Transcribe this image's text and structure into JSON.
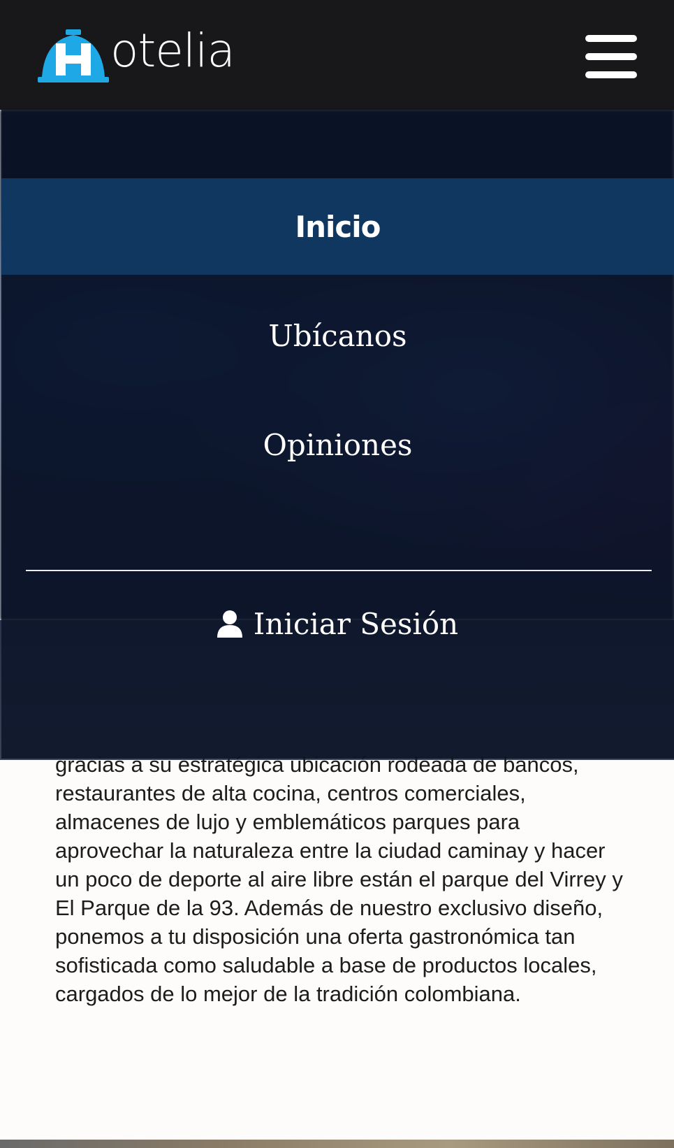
{
  "header": {
    "brand_first_letter": "H",
    "brand_rest": "otelia",
    "menu_icon": "hamburger-icon"
  },
  "menu": {
    "items": [
      {
        "label": "Inicio",
        "active": true
      },
      {
        "label": "Ubícanos",
        "active": false
      },
      {
        "label": "Opiniones",
        "active": false
      }
    ],
    "login_label": "Iniciar Sesión",
    "login_icon": "user-icon"
  },
  "content": {
    "paragraph": "gracias a su estratégica ubicación rodeada de bancos, restaurantes de alta cocina, centros comerciales, almacenes de lujo y emblemáticos parques para aprovechar la naturaleza entre la ciudad caminay y hacer un poco de deporte al aire libre están el parque del Virrey y El Parque de la 93. Además de nuestro exclusivo diseño, ponemos a tu disposición una oferta gastronómica tan sofisticada como saludable a base de productos locales, cargados de lo mejor de la tradición colombiana."
  },
  "colors": {
    "header_bg": "#18181a",
    "logo_blue": "#1ea8e6",
    "active_menu_bg": "#10375f",
    "menu_overlay": "#0a1226"
  }
}
